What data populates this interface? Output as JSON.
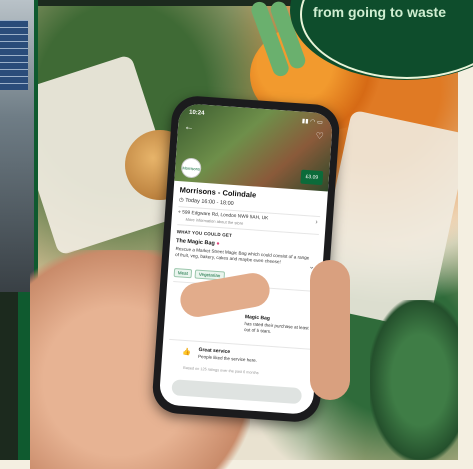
{
  "banner": {
    "text": "from going to waste"
  },
  "app": {
    "status_time": "10:24",
    "status_icons": "▮▮ ◠ ▭",
    "back_glyph": "←",
    "heart_glyph": "♡",
    "logo_text": "Morrisons",
    "price": "£3.09",
    "store_name": "Morrisons - Colindale",
    "pickup_time": "Today 16:00 - 18:00",
    "address": "599 Edgware Rd, London NW9 5AH, UK",
    "address_sub": "More information about the store",
    "section_title": "WHAT YOU COULD GET",
    "bag_title": "The Magic Bag",
    "description": "Rescue a Market Street Magic Bag which could consist of a range of fruit, veg, bakery, cakes and maybe even cheese!",
    "tags": [
      "Meat",
      "Vegetarian"
    ],
    "review_title": "Magic Bag",
    "review_text": "has rated their purchase at least 3 out of 5 stars.",
    "service_title": "Great service",
    "service_text": "People liked the service here.",
    "footnote": "Based on 125 ratings over the past 6 months",
    "chevron": "›",
    "service_icon": "👍"
  },
  "colors": {
    "brand_green": "#0b6b3a",
    "badge_green": "#0e4d2c"
  }
}
